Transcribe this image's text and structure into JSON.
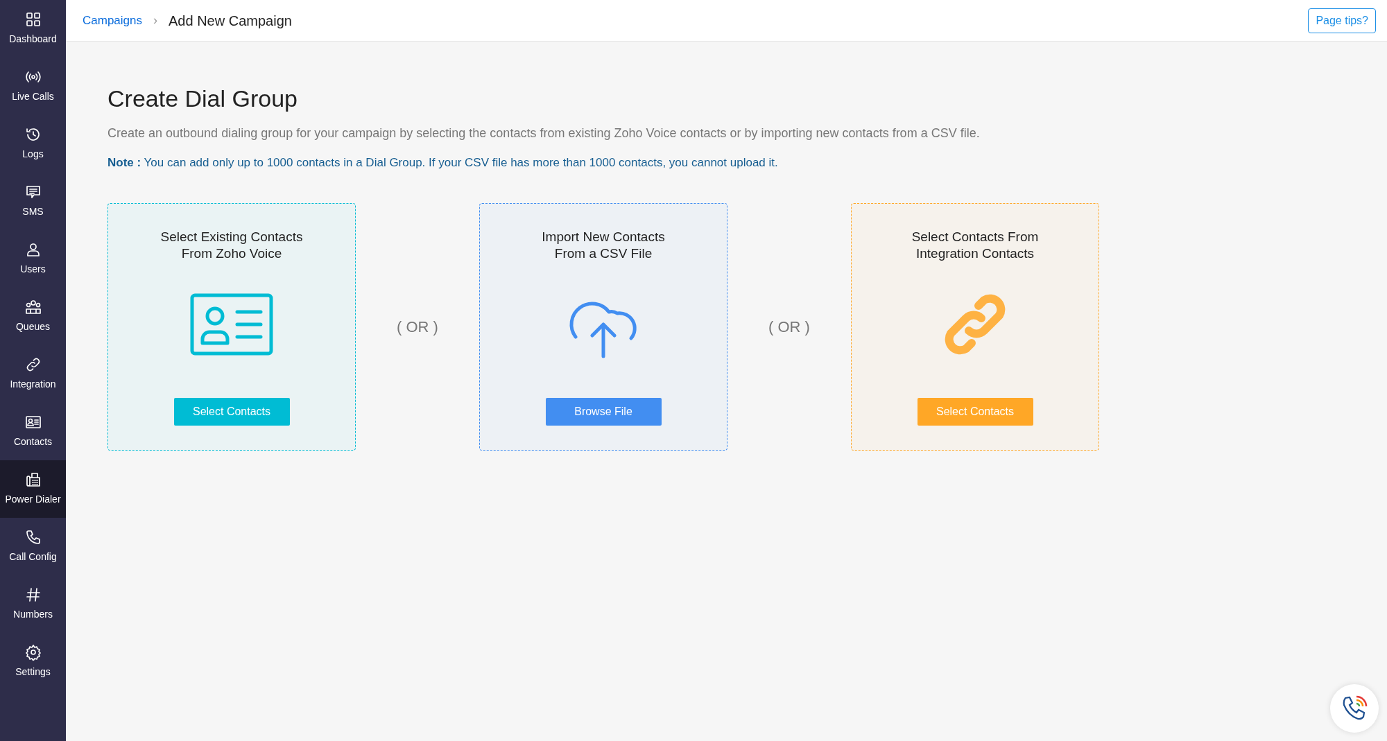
{
  "sidebar": {
    "items": [
      {
        "label": "Dashboard",
        "kind": "grid",
        "selected": false
      },
      {
        "label": "Live Calls",
        "kind": "broadcast",
        "selected": false
      },
      {
        "label": "Logs",
        "kind": "history",
        "selected": false
      },
      {
        "label": "SMS",
        "kind": "message",
        "selected": false
      },
      {
        "label": "Users",
        "kind": "user",
        "selected": false
      },
      {
        "label": "Queues",
        "kind": "people",
        "selected": false
      },
      {
        "label": "Integration",
        "kind": "link",
        "selected": false
      },
      {
        "label": "Contacts",
        "kind": "card",
        "selected": false
      },
      {
        "label": "Power Dialer",
        "kind": "fax",
        "selected": true
      },
      {
        "label": "Call Config",
        "kind": "phone",
        "selected": false
      },
      {
        "label": "Numbers",
        "kind": "hash",
        "selected": false
      },
      {
        "label": "Settings",
        "kind": "gear",
        "selected": false
      }
    ]
  },
  "breadcrumb": {
    "parent": "Campaigns",
    "separator": "›",
    "current": "Add New Campaign"
  },
  "page_tips": "Page tips?",
  "heading": "Create Dial Group",
  "description": "Create an outbound dialing group for your campaign by selecting the contacts from existing Zoho Voice contacts or by importing new contacts from a CSV file.",
  "note": "**Note :** You can add only up to 1000 contacts in a Dial Group. If your CSV file has more than 1000 contacts, you cannot upload it.",
  "separators": [
    "( OR )",
    "( OR )"
  ],
  "options": [
    {
      "title": "Select Existing Contacts\nFrom Zoho Voice",
      "kind": "contact",
      "color": "#00bcd4",
      "button": "Select Contacts"
    },
    {
      "title": "Import New Contacts\nFrom a CSV File",
      "kind": "upload",
      "color": "#428ef1",
      "button": "Browse File"
    },
    {
      "title": "Select Contacts From\nIntegration Contacts",
      "kind": "link",
      "color": "#ffa726",
      "button": "Select Contacts"
    }
  ]
}
